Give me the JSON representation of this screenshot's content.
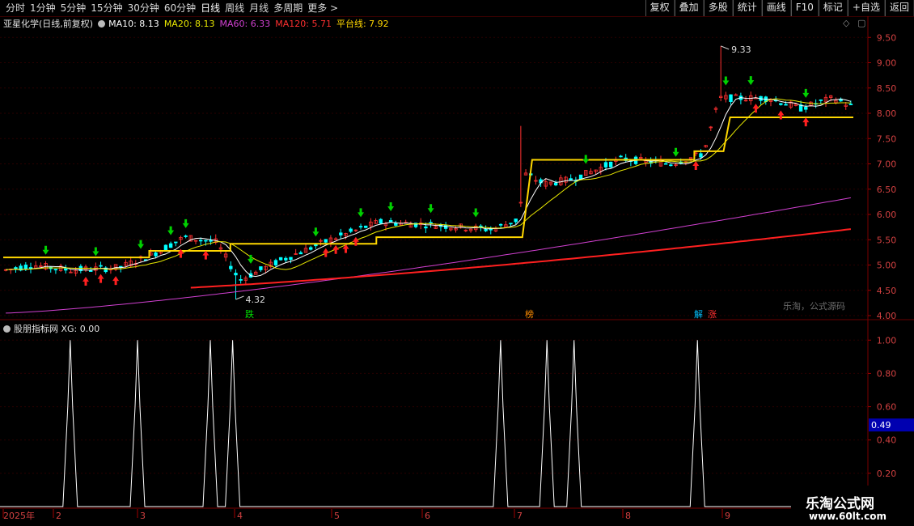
{
  "toolbar": {
    "periods": [
      "分时",
      "1分钟",
      "5分钟",
      "15分钟",
      "30分钟",
      "60分钟",
      "日线",
      "周线",
      "月线",
      "多周期",
      "更多 >"
    ],
    "active_period": "日线",
    "right_buttons": [
      "复权",
      "叠加",
      "多股",
      "统计",
      "画线",
      "F10",
      "标记",
      "+自选",
      "返回"
    ]
  },
  "legend": {
    "stock": "亚星化学(日线,前复权)",
    "ma10": "MA10: 8.13",
    "ma20": "MA20: 8.13",
    "ma60": "MA60: 6.33",
    "ma120": "MA120: 5.71",
    "platform": "平台线: 7.92"
  },
  "price_axis": [
    "9.50",
    "9.00",
    "8.50",
    "8.00",
    "7.50",
    "7.00",
    "6.50",
    "6.00",
    "5.50",
    "5.00",
    "4.50",
    "4.00"
  ],
  "annotations": {
    "high": "9.33",
    "low": "4.32"
  },
  "tags": [
    {
      "text": "跌",
      "color": "#00e000"
    },
    {
      "text": "榜",
      "color": "#ff8c00"
    },
    {
      "text": "解",
      "color": "#00c0ff"
    },
    {
      "text": "涨",
      "color": "#ff3030"
    }
  ],
  "sub_legend": {
    "name": "股朋指标网",
    "value": "XG: 0.00"
  },
  "sub_axis": [
    "1.00",
    "0.80",
    "0.60",
    "0.40",
    "0.20"
  ],
  "sub_current": "0.49",
  "date_axis": [
    "2025年",
    "2",
    "3",
    "4",
    "5",
    "6",
    "7",
    "8",
    "9"
  ],
  "watermark": "乐淘，公式源码",
  "brand": {
    "title": "乐淘公式网",
    "url": "www.60lt.com"
  },
  "colors": {
    "ma10": "#ffffff",
    "ma20": "#e8e800",
    "ma60": "#d040d0",
    "ma120": "#ff2020",
    "platform": "#ffd700",
    "up": "#ff3030",
    "down": "#00ffff",
    "buy_arrow": "#ff2020",
    "sell_arrow": "#00d000"
  },
  "chart_data": {
    "type": "line",
    "title": "亚星化学(日线,前复权)",
    "y_range": [
      4.0,
      9.6
    ],
    "series": [
      {
        "name": "平台线",
        "values": [
          5.15,
          5.15,
          5.15,
          5.15,
          5.15,
          5.15,
          5.15,
          5.15,
          5.15,
          5.15,
          5.15,
          5.15,
          5.15,
          5.15,
          5.15,
          5.15,
          5.15,
          5.15,
          5.15,
          5.15,
          5.15,
          5.15,
          5.15,
          5.15,
          5.15,
          5.15,
          5.15,
          5.15,
          5.15,
          5.15,
          5.15,
          5.15,
          5.15,
          5.15,
          5.15,
          5.15,
          5.15,
          5.15,
          5.15,
          5.15,
          5.15,
          5.15,
          5.15,
          5.15,
          5.15,
          5.15,
          5.15,
          5.15,
          5.15,
          5.15,
          5.15,
          5.15,
          5.15,
          5.15,
          5.15,
          5.15,
          5.15,
          5.15,
          5.15,
          5.15,
          5.15,
          5.15,
          5.15,
          5.15,
          5.15,
          5.15,
          5.15,
          5.15,
          5.15,
          5.15,
          5.42,
          5.42,
          5.42,
          5.42,
          5.42,
          5.42,
          5.42,
          5.42,
          5.42,
          5.42,
          5.42,
          5.42,
          5.42,
          5.42,
          5.42,
          5.42,
          5.42,
          5.42,
          5.42,
          5.42,
          5.42,
          5.42,
          5.42,
          5.42,
          5.42,
          5.42,
          5.42,
          5.42,
          5.42,
          5.42,
          5.42,
          5.42,
          5.42,
          5.42,
          5.42,
          5.42,
          5.42,
          5.42,
          5.42,
          5.42,
          5.42,
          5.42,
          5.42,
          5.42,
          5.42
        ]
      },
      {
        "name": "MA60",
        "values": [
          4.05,
          6.33
        ]
      },
      {
        "name": "MA120",
        "values": [
          4.42,
          5.71
        ]
      }
    ],
    "highest": 9.33,
    "lowest": 4.32,
    "x_labels": [
      "2025年",
      "2",
      "3",
      "4",
      "5",
      "6",
      "7",
      "8",
      "9"
    ]
  },
  "sub_chart_data": {
    "type": "line",
    "name": "XG",
    "value_label": "XG: 0.00",
    "spikes_at_month_fraction": [
      1.2,
      2.0,
      2.75,
      2.98,
      5.85,
      6.3,
      6.55,
      7.75
    ],
    "y_range": [
      0,
      1.05
    ]
  }
}
